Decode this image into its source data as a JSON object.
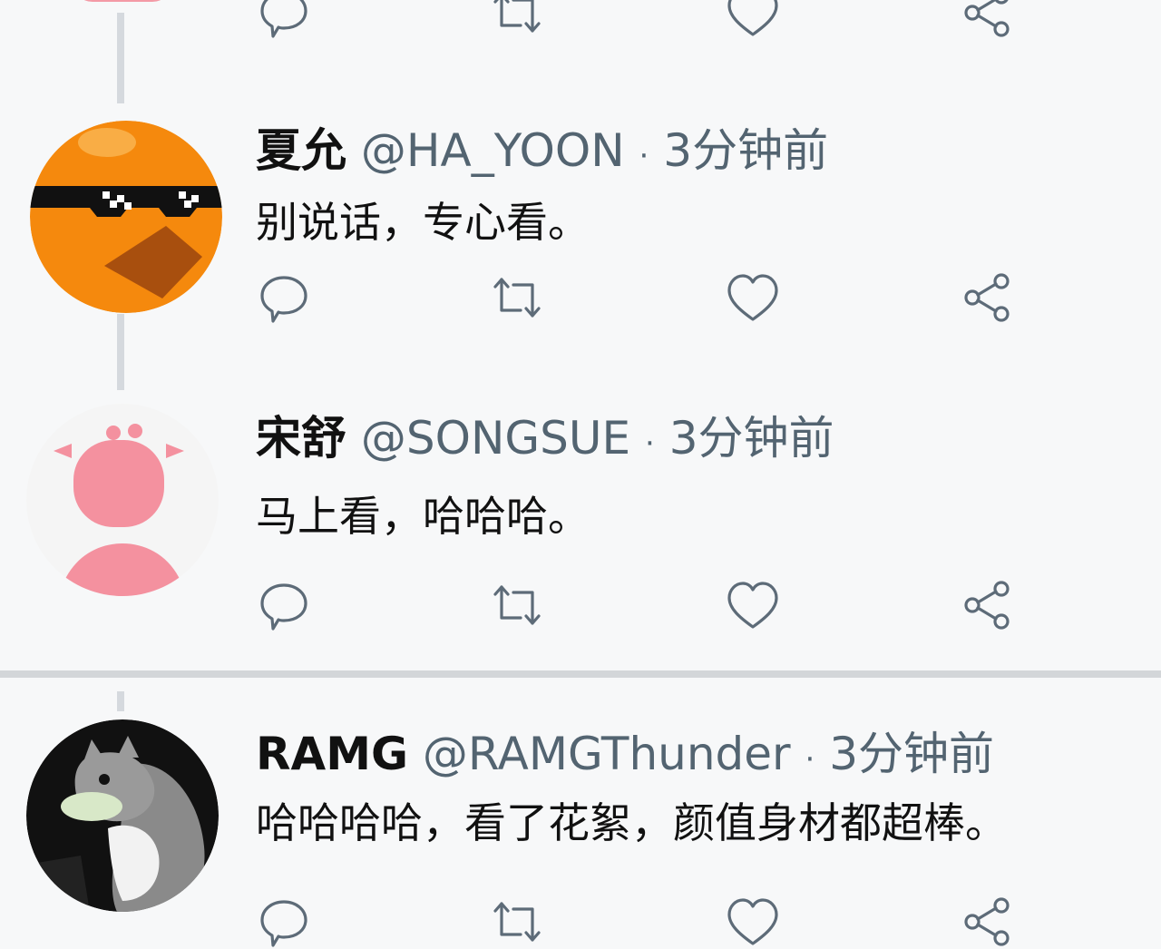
{
  "tweets": [
    {
      "name": "夏允",
      "handle": "@HA_YOON",
      "separator": "·",
      "time": "3分钟前",
      "text": "别说话，专心看。"
    },
    {
      "name": "宋舒",
      "handle": "@SONGSUE",
      "separator": "·",
      "time": "3分钟前",
      "text": "马上看，哈哈哈。"
    },
    {
      "name": "RAMG",
      "handle": "@RAMGThunder",
      "separator": "·",
      "time": "3分钟前",
      "text": "哈哈哈哈，看了花絮，颜值身材都超棒。"
    }
  ],
  "actions": [
    "reply-icon",
    "retweet-icon",
    "like-icon",
    "share-icon"
  ],
  "colors": {
    "background": "#f7f8f9",
    "secondary_text": "#536471",
    "icon": "#5d6b78",
    "thread_line": "#d5d9de"
  }
}
